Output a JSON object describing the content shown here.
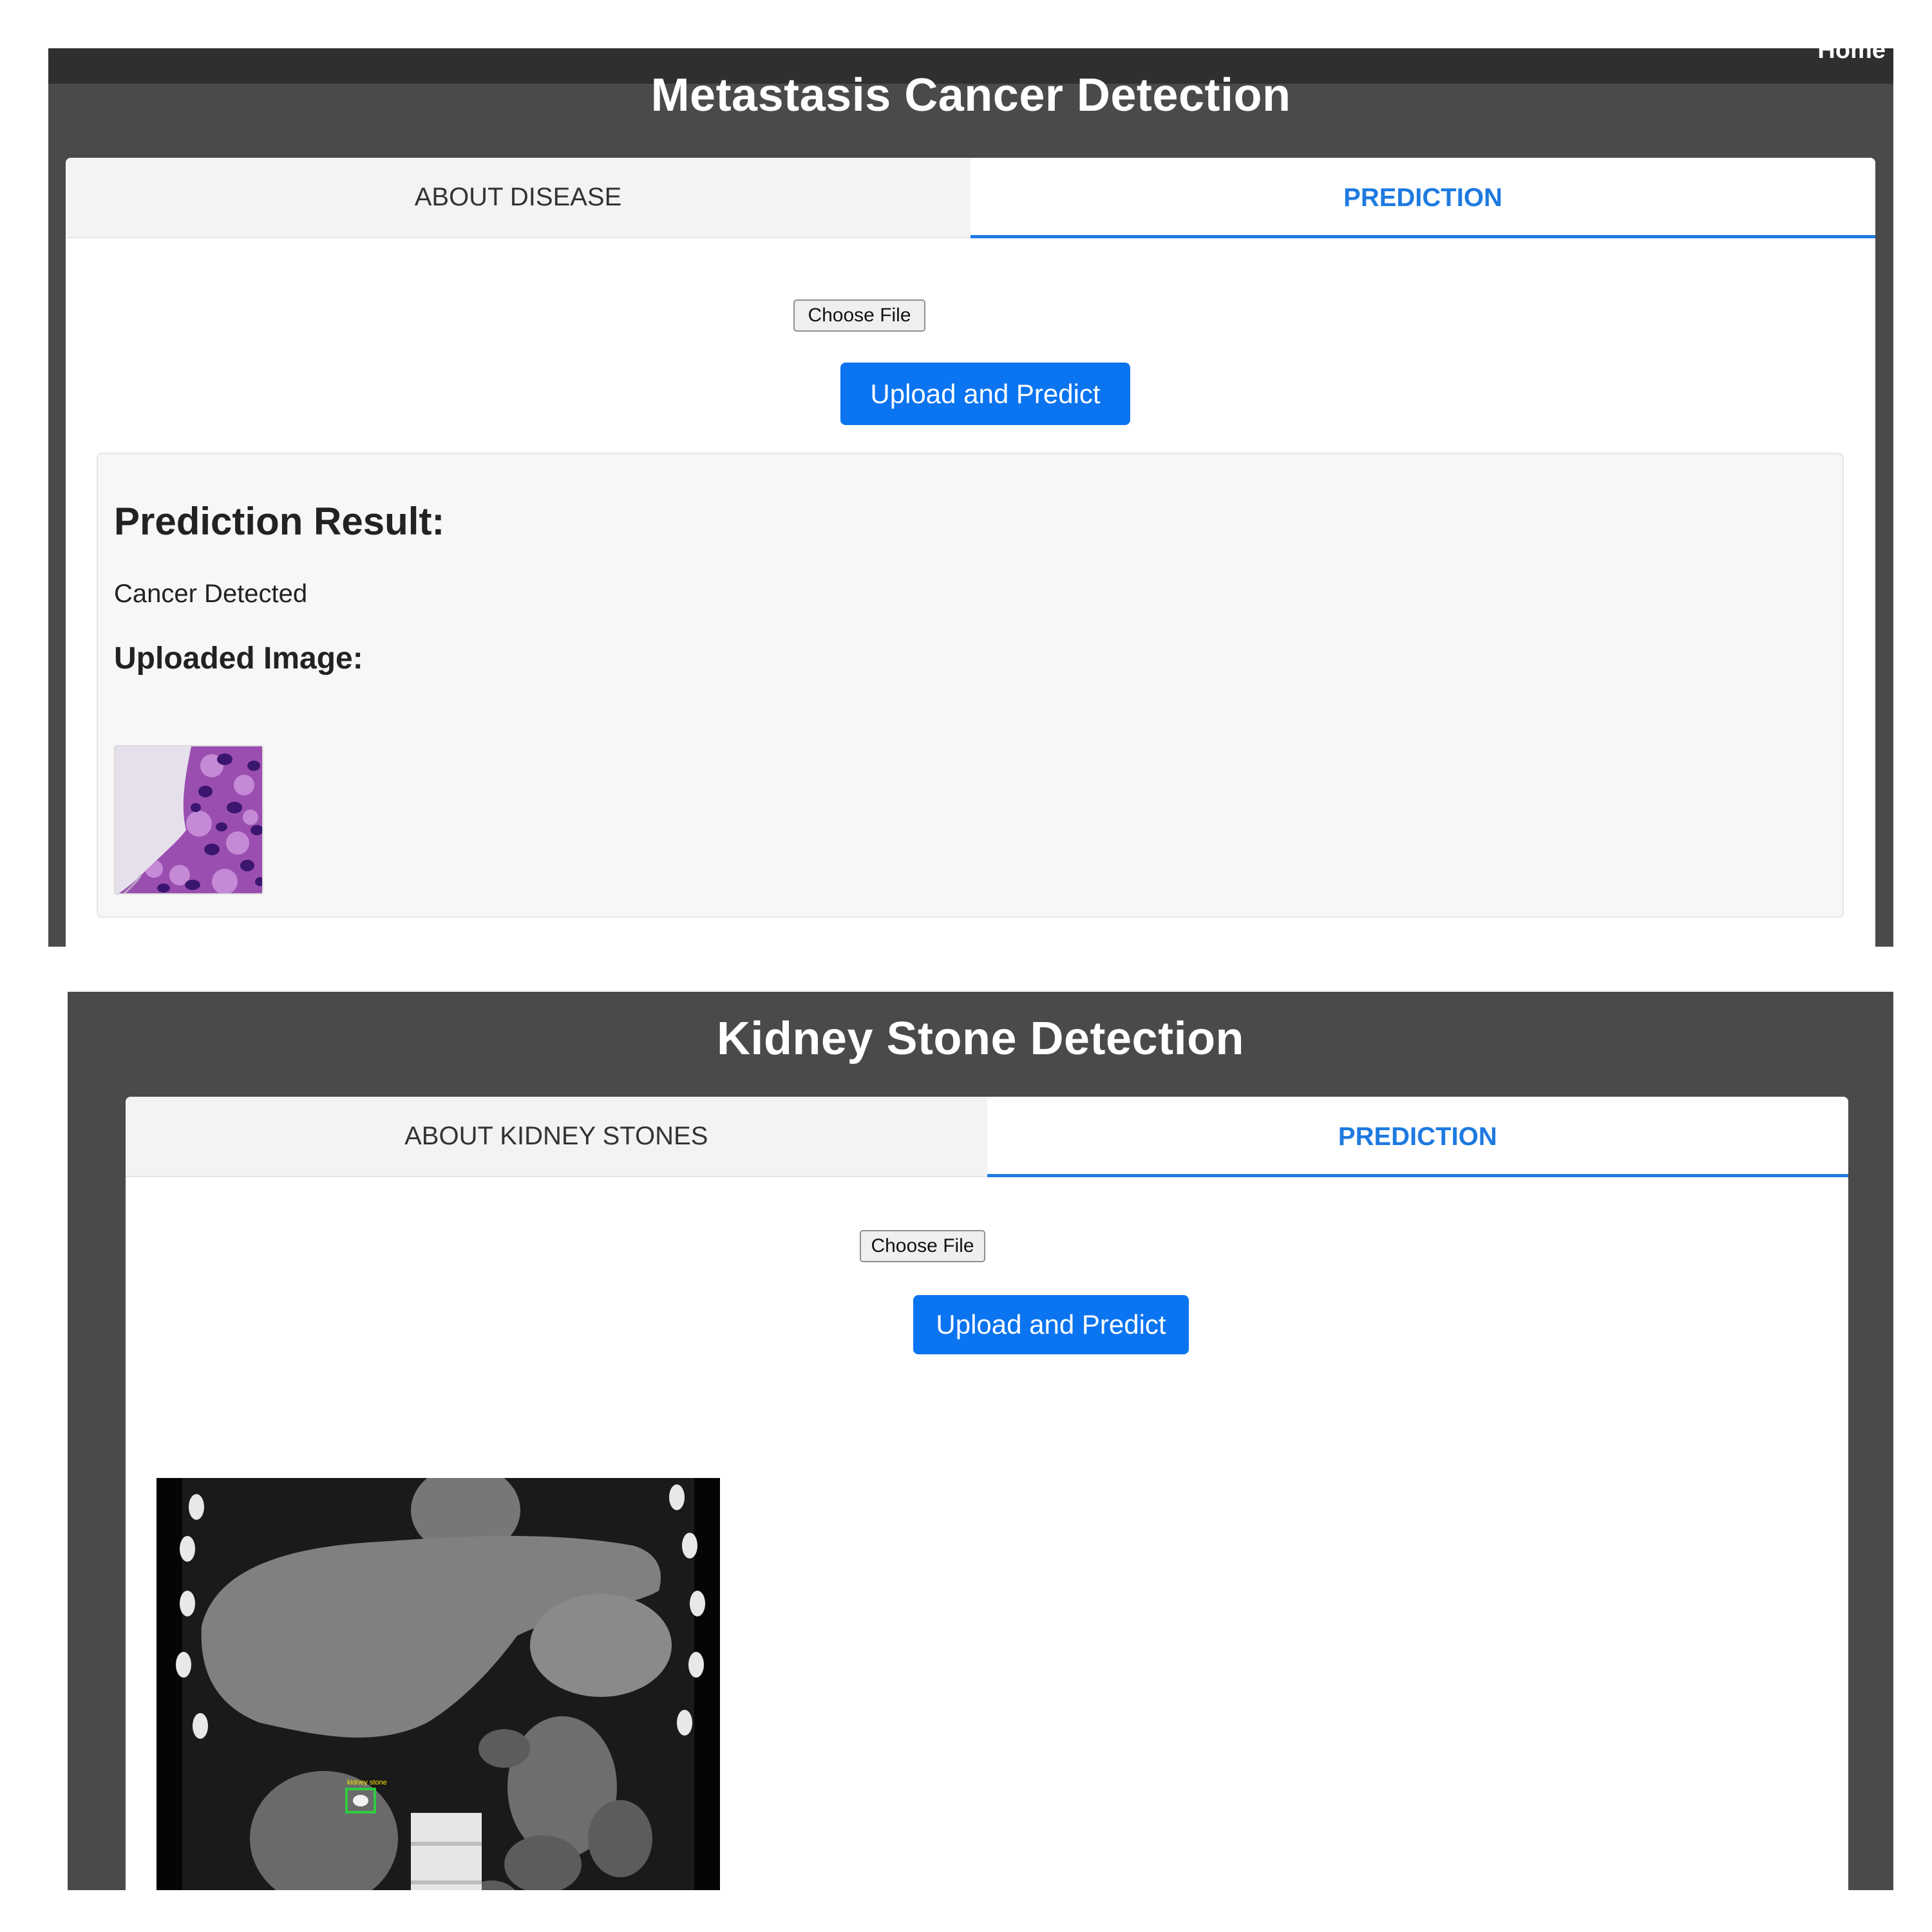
{
  "panels": [
    {
      "nav_link": "Home",
      "title": "Metastasis Cancer Detection",
      "tabs": [
        {
          "label": "ABOUT DISEASE"
        },
        {
          "label": "PREDICTION"
        }
      ],
      "choose_file_label": "Choose File",
      "upload_button_label": "Upload and Predict",
      "result": {
        "heading": "Prediction Result:",
        "text": "Cancer Detected",
        "image_heading": "Uploaded Image:"
      }
    },
    {
      "title": "Kidney Stone Detection",
      "tabs": [
        {
          "label": "ABOUT KIDNEY STONES"
        },
        {
          "label": "PREDICTION"
        }
      ],
      "choose_file_label": "Choose File",
      "upload_button_label": "Upload and Predict",
      "detection_label": "kidney stone"
    }
  ],
  "colors": {
    "accent": "#1e7ae0",
    "button": "#0b74f0",
    "page_bg": "#4a4a4a",
    "detection_box": "#2ecc40",
    "detection_label": "#f2e600"
  }
}
